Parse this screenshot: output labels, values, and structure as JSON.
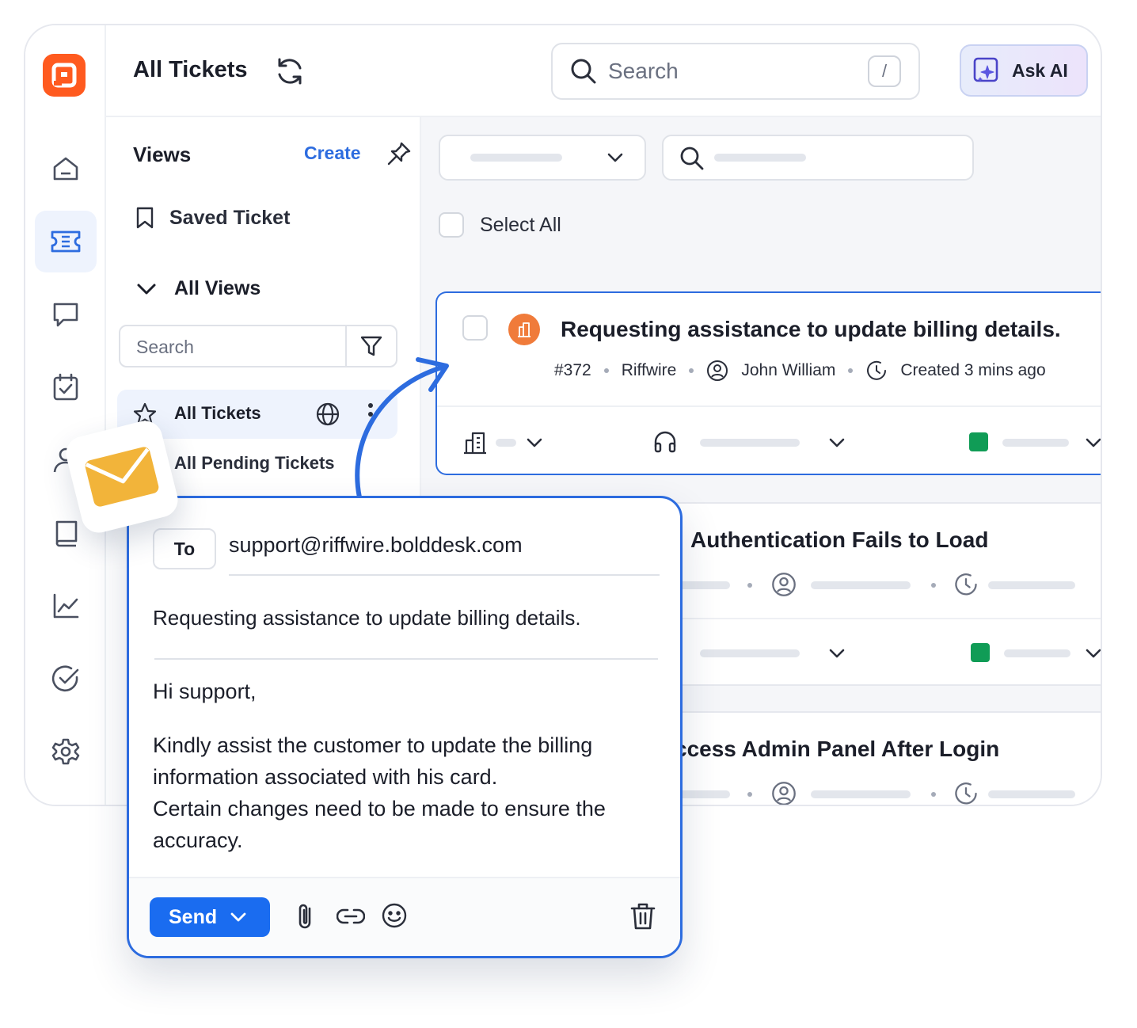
{
  "header": {
    "title": "All Tickets",
    "search_placeholder": "Search",
    "search_shortcut": "/",
    "ask_ai_label": "Ask AI"
  },
  "rail": {
    "items": [
      "home-icon",
      "ticket-icon",
      "chat-icon",
      "calendar-check-icon",
      "user-icon",
      "book-icon",
      "chart-icon",
      "check-circle-icon",
      "gear-icon"
    ],
    "active": "ticket-icon"
  },
  "views": {
    "title": "Views",
    "create_label": "Create",
    "saved_label": "Saved Ticket",
    "all_views_label": "All Views",
    "search_placeholder": "Search",
    "items": [
      {
        "label": "All Tickets",
        "active": true
      },
      {
        "label": "All Pending Tickets",
        "active": false
      }
    ]
  },
  "list": {
    "select_all_label": "Select All",
    "tickets": [
      {
        "title": "Requesting assistance to update billing details.",
        "id": "#372",
        "org": "Riffwire",
        "contact": "John William",
        "created": "Created 3 mins ago",
        "selected": true
      },
      {
        "title_visible": "Authentication Fails to Load"
      },
      {
        "title_visible": "ccess Admin Panel After Login"
      }
    ]
  },
  "compose": {
    "to_label": "To",
    "to_address": "support@riffwire.bolddesk.com",
    "subject": "Requesting assistance to update billing details.",
    "greeting": "Hi support,",
    "body_line1": "Kindly assist the customer to update the billing information associated with his card.",
    "body_line2": "Certain changes need to be made to ensure the accuracy.",
    "send_label": "Send"
  },
  "colors": {
    "brand": "#ff5a1f",
    "accent": "#2d6cdf",
    "send_button": "#1a6cf0",
    "status_green": "#109c56",
    "envelope": "#f2b43a"
  }
}
